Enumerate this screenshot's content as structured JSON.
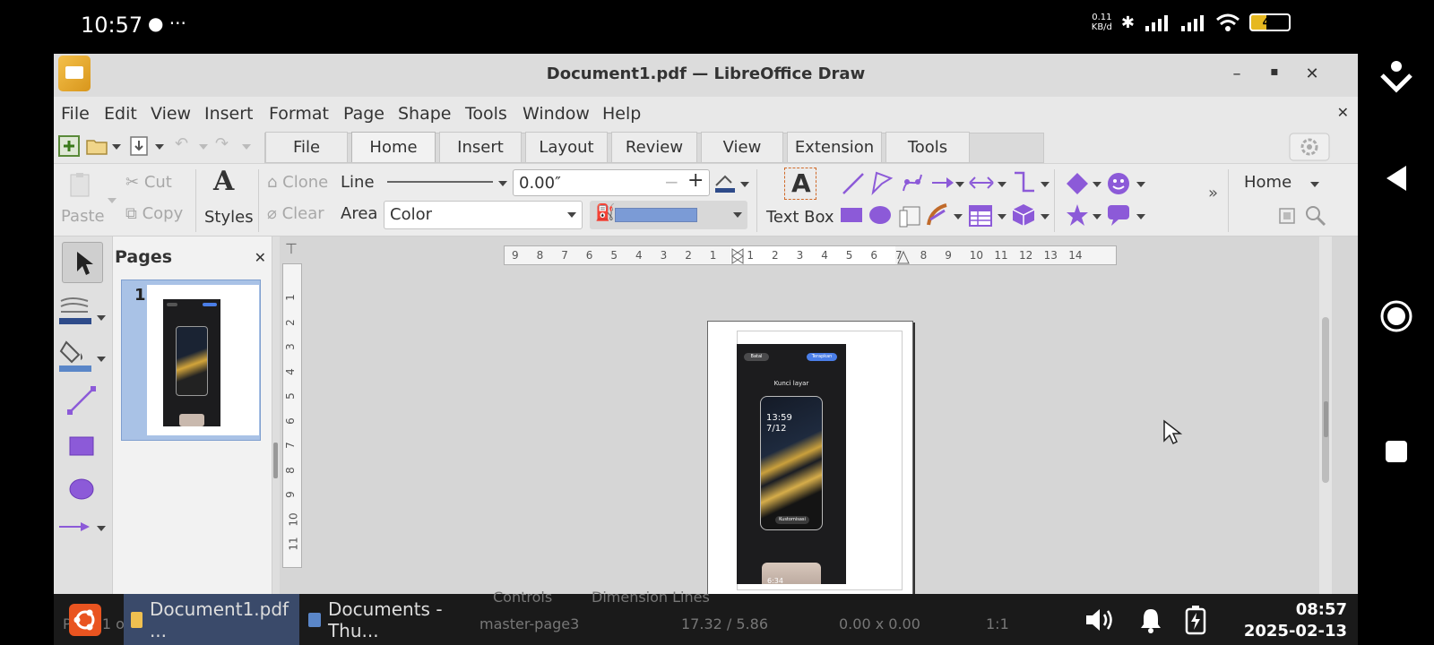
{
  "status_bar": {
    "time": "10:57",
    "left_icons": "● ···",
    "net_speed_top": "0.11",
    "net_speed_bottom": "KB/d",
    "battery": "41"
  },
  "window": {
    "title": "Document1.pdf — LibreOffice Draw"
  },
  "menu": [
    "File",
    "Edit",
    "View",
    "Insert",
    "Format",
    "Page",
    "Shape",
    "Tools",
    "Window",
    "Help"
  ],
  "tabs": [
    "File",
    "Home",
    "Insert",
    "Layout",
    "Review",
    "View",
    "Extension",
    "Tools"
  ],
  "ribbon": {
    "paste": "Paste",
    "cut": "Cut",
    "copy": "Copy",
    "styles": "Styles",
    "clone": "Clone",
    "clear": "Clear",
    "line_label": "Line",
    "area_label": "Area",
    "line_width": "0.00″",
    "area_value": "Color",
    "text_box": "Text Box",
    "home_dropdown": "Home",
    "more": "»",
    "fill_color": "#7b9bd6",
    "accent_color": "#8c5ad8"
  },
  "pages_panel": {
    "title": "Pages",
    "page_number": "1"
  },
  "horizontal_ruler": [
    "9",
    "8",
    "7",
    "6",
    "5",
    "4",
    "3",
    "2",
    "1",
    "1",
    "2",
    "3",
    "4",
    "5",
    "6",
    "7",
    "8",
    "9",
    "10",
    "11",
    "12",
    "13",
    "14"
  ],
  "vertical_ruler": [
    "1",
    "2",
    "3",
    "4",
    "5",
    "6",
    "7",
    "8",
    "9",
    "10",
    "11"
  ],
  "phone_content": {
    "cancel": "Batal",
    "apply": "Terapkan",
    "title": "Kunci layar",
    "clock": "13:59",
    "date": "7/12",
    "customize": "Kustomisasi",
    "preview_time": "6:34"
  },
  "sidebar_tabs": {
    "controls": "Controls",
    "dimension_lines": "Dimension Lines"
  },
  "status_ghost": {
    "page": "Page 1 o",
    "master": "master-page3",
    "position": "17.32 / 5.86",
    "size": "0.00 x 0.00",
    "scale": "1:1"
  },
  "taskbar": {
    "task1": "Document1.pdf ...",
    "task2": "Documents - Thu...",
    "time": "08:57",
    "date": "2025-02-13"
  }
}
